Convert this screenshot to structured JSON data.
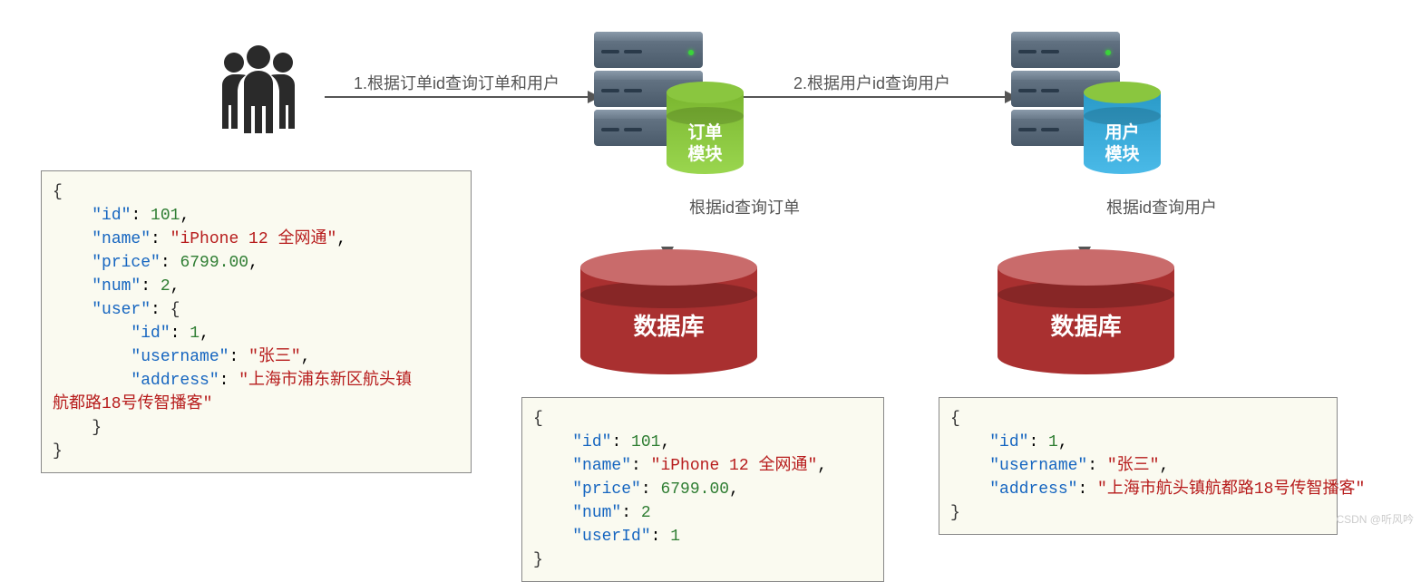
{
  "arrows": {
    "step1_label": "1.根据订单id查询订单和用户",
    "step2_label": "2.根据用户id查询用户",
    "order_db_label": "根据id查询订单",
    "user_db_label": "根据id查询用户"
  },
  "modules": {
    "order_label_line1": "订单",
    "order_label_line2": "模块",
    "user_label_line1": "用户",
    "user_label_line2": "模块"
  },
  "databases": {
    "order_label": "数据库",
    "user_label": "数据库"
  },
  "json_combined": {
    "id": 101,
    "name": "iPhone 12 全网通",
    "price": 6799.0,
    "num": 2,
    "user": {
      "id": 1,
      "username": "张三",
      "address": "上海市浦东新区航头镇航都路18号传智播客"
    }
  },
  "json_order": {
    "id": 101,
    "name": "iPhone 12 全网通",
    "price": 6799.0,
    "num": 2,
    "userId": 1
  },
  "json_user": {
    "id": 1,
    "username": "张三",
    "address": "上海市航头镇航都路18号传智播客"
  },
  "json_display": {
    "combined": "{\n    \"id\": 101,\n    \"name\": \"iPhone 12 全网通\",\n    \"price\": 6799.00,\n    \"num\": 2,\n    \"user\": {\n        \"id\": 1,\n        \"username\": \"张三\",\n        \"address\": \"上海市浦东新区航头镇\n航都路18号传智播客\"\n    }\n}",
    "order": "{\n    \"id\": 101,\n    \"name\": \"iPhone 12 全网通\",\n    \"price\": 6799.00,\n    \"num\": 2\n    \"userId\": 1\n}",
    "user": "{\n    \"id\": 1,\n    \"username\": \"张三\",\n    \"address\": \"上海市航头镇航都路18号传智播客\"\n}"
  },
  "watermark": "CSDN @听风吟"
}
